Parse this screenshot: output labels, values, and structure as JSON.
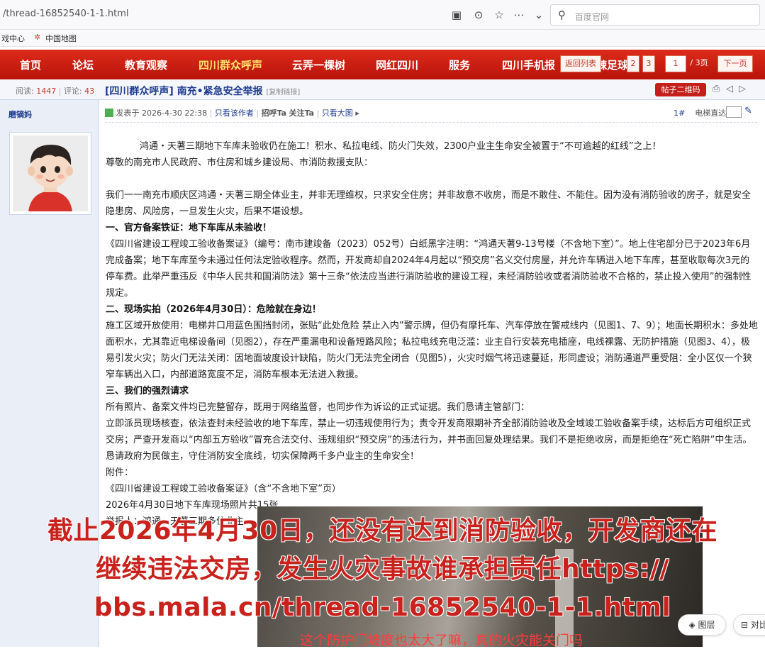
{
  "browser": {
    "url": "/thread-16852540-1-1.html",
    "search_placeholder": "百度官网",
    "bookmarks": [
      "戏中心",
      "中国地图"
    ]
  },
  "nav": {
    "items": [
      "首页",
      "论坛",
      "教育观察",
      "四川群众呼声",
      "云弄一棵树",
      "网红四川",
      "服务",
      "四川手机报",
      "麻辣足球"
    ],
    "active_index": 3,
    "pager": {
      "prev": "返回列表",
      "p2": "2",
      "p3": "3",
      "current": "1",
      "total": "/ 3页",
      "next": "下一页"
    }
  },
  "thread": {
    "reads_label": "阅读:",
    "reads": "1447",
    "comments_label": "评论:",
    "comments": "43",
    "title": "[四川群众呼声] 南充•紧急安全举报",
    "copy_link": "[复制链接]",
    "qr_button": "帖子二维码"
  },
  "author": {
    "name": "磨镝妈"
  },
  "post": {
    "posted": "发表于 2026-4-30 22:38",
    "only_author": "只看该作者",
    "follow_ta": "招呼Ta",
    "attention_ta": "关注Ta",
    "big_pic": "只看大图",
    "floor": "1#",
    "floor_jump": "电梯直达",
    "lines": [
      "鸿通・天著三期地下车库未验收仍在施工！积水、私拉电线、防火门失效，2300户业主生命安全被置于“不可逾越的红线”之上！",
      "尊敬的南充市人民政府、市住房和城乡建设局、市消防救援支队：",
      "",
      "我们一一南充市顺庆区鸿通・天著三期全体业主，并非无理维权，只求安全住房；并非故意不收房，而是不敢住、不能住。因为没有消防验收的房子，就是安全隐患房、风险房，一旦发生火灾，后果不堪设想。",
      "一、官方备案铁证：地下车库从未验收！",
      "《四川省建设工程竣工验收备案证》（编号：南市建竣备（2023）052号）白纸黑字注明：“鸿通天著9-13号楼（不含地下室）”。地上住宅部分已于2023年6月完成备案；地下车库至今未通过任何法定验收程序。然而，开发商却自2024年4月起以“预交房”名义交付房屋，并允许车辆进入地下车库，甚至收取每次3元的停车费。此举严重违反《中华人民共和国消防法》第十三条“依法应当进行消防验收的建设工程，未经消防验收或者消防验收不合格的，禁止投入使用”的强制性规定。",
      "二、现场实拍（2026年4月30日）：危险就在身边！",
      "施工区域开放使用：电梯井口用蓝色围挡封闭，张贴“此处危险 禁止入内”警示牌，但仍有摩托车、汽车停放在警戒线内（见图1、7、9）；地面长期积水：多处地面积水，尤其靠近电梯设备间（见图2），存在严重漏电和设备短路风险；私拉电线充电泛滥：业主自行安装充电插座，电线裸露、无防护措施（见图3、4），极易引发火灾；防火门无法关闭：因地面坡度设计缺陷，防火门无法完全闭合（见图5），火灾时烟气将迅速蔓延，形同虚设；消防通道严重受阻：全小区仅一个狭窄车辆出入口，内部道路宽度不足，消防车根本无法进入救援。",
      "三、我们的强烈请求",
      "所有照片、备案文件均已完整留存，既用于网络监督，也同步作为诉讼的正式证据。我们恳请主管部门：",
      "立即派员现场核查，依法查封未经验收的地下车库，禁止一切违规使用行为；责令开发商限期补齐全部消防验收及全域竣工验收备案手续，达标后方可组织正式交房；严查开发商以“内部五方验收”冒充合法交付、违规组织“预交房”的违法行为，并书面回复处理结果。我们不是拒绝收房，而是拒绝在“死亡陷阱”中生活。恳请政府为民做主，守住消防安全底线，切实保障两千多户业主的生命安全！",
      "附件：",
      "《四川省建设工程竣工验收备案证》（含“不含地下室”页）",
      "2026年4月30日地下车库现场照片共15张",
      "举报人：鸿通・天著三期多位业主"
    ]
  },
  "overlay": {
    "line1": "截止2026年4月30日，还没有达到消防验收，开发商还在",
    "line2": "继续违法交房，发生火灾事故谁承担责任https://",
    "line3": "bbs.mala.cn/thread-16852540-1-1.html",
    "photo_caption": "这个防护门坡度也太大了嘛，真的火灾能关门吗",
    "layer_button": "图层",
    "compare_button": "对比"
  }
}
